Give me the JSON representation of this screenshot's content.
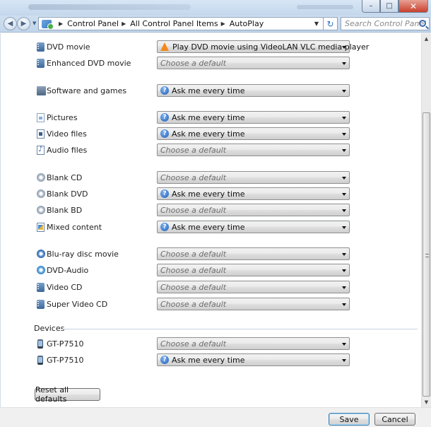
{
  "window": {
    "minimize_glyph": "–",
    "maximize_glyph": "□",
    "close_glyph": "✕"
  },
  "nav": {
    "breadcrumbs": [
      "Control Panel",
      "All Control Panel Items",
      "AutoPlay"
    ],
    "search_placeholder": "Search Control Panel"
  },
  "media_rows": [
    {
      "label": "DVD movie",
      "icon": "dvd-movie-icon",
      "value": "Play DVD movie using VideoLAN VLC media player",
      "kind": "vlc"
    },
    {
      "label": "Enhanced DVD movie",
      "icon": "enhanced-dvd-icon",
      "value": "Choose a default",
      "kind": "placeholder"
    },
    {
      "label": "Software and games",
      "icon": "software-games-icon",
      "value": "Ask me every time",
      "kind": "ask"
    },
    {
      "label": "Pictures",
      "icon": "pictures-icon",
      "value": "Ask me every time",
      "kind": "ask"
    },
    {
      "label": "Video files",
      "icon": "video-files-icon",
      "value": "Ask me every time",
      "kind": "ask"
    },
    {
      "label": "Audio files",
      "icon": "audio-files-icon",
      "value": "Choose a default",
      "kind": "placeholder"
    },
    {
      "label": "Blank CD",
      "icon": "blank-cd-icon",
      "value": "Choose a default",
      "kind": "placeholder"
    },
    {
      "label": "Blank DVD",
      "icon": "blank-dvd-icon",
      "value": "Ask me every time",
      "kind": "ask"
    },
    {
      "label": "Blank BD",
      "icon": "blank-bd-icon",
      "value": "Choose a default",
      "kind": "placeholder"
    },
    {
      "label": "Mixed content",
      "icon": "mixed-content-icon",
      "value": "Ask me every time",
      "kind": "ask"
    },
    {
      "label": "Blu-ray disc movie",
      "icon": "bluray-disc-icon",
      "value": "Choose a default",
      "kind": "placeholder"
    },
    {
      "label": "DVD-Audio",
      "icon": "dvd-audio-icon",
      "value": "Choose a default",
      "kind": "placeholder"
    },
    {
      "label": "Video CD",
      "icon": "video-cd-icon",
      "value": "Choose a default",
      "kind": "placeholder"
    },
    {
      "label": "Super Video CD",
      "icon": "super-video-cd-icon",
      "value": "Choose a default",
      "kind": "placeholder"
    }
  ],
  "devices": {
    "heading": "Devices",
    "rows": [
      {
        "label": "GT-P7510",
        "icon": "phone-device-icon",
        "value": "Choose a default",
        "kind": "placeholder"
      },
      {
        "label": "GT-P7510",
        "icon": "phone-device-icon",
        "value": "Ask me every time",
        "kind": "ask"
      }
    ]
  },
  "actions": {
    "reset_label": "Reset all defaults",
    "save_label": "Save",
    "cancel_label": "Cancel"
  }
}
